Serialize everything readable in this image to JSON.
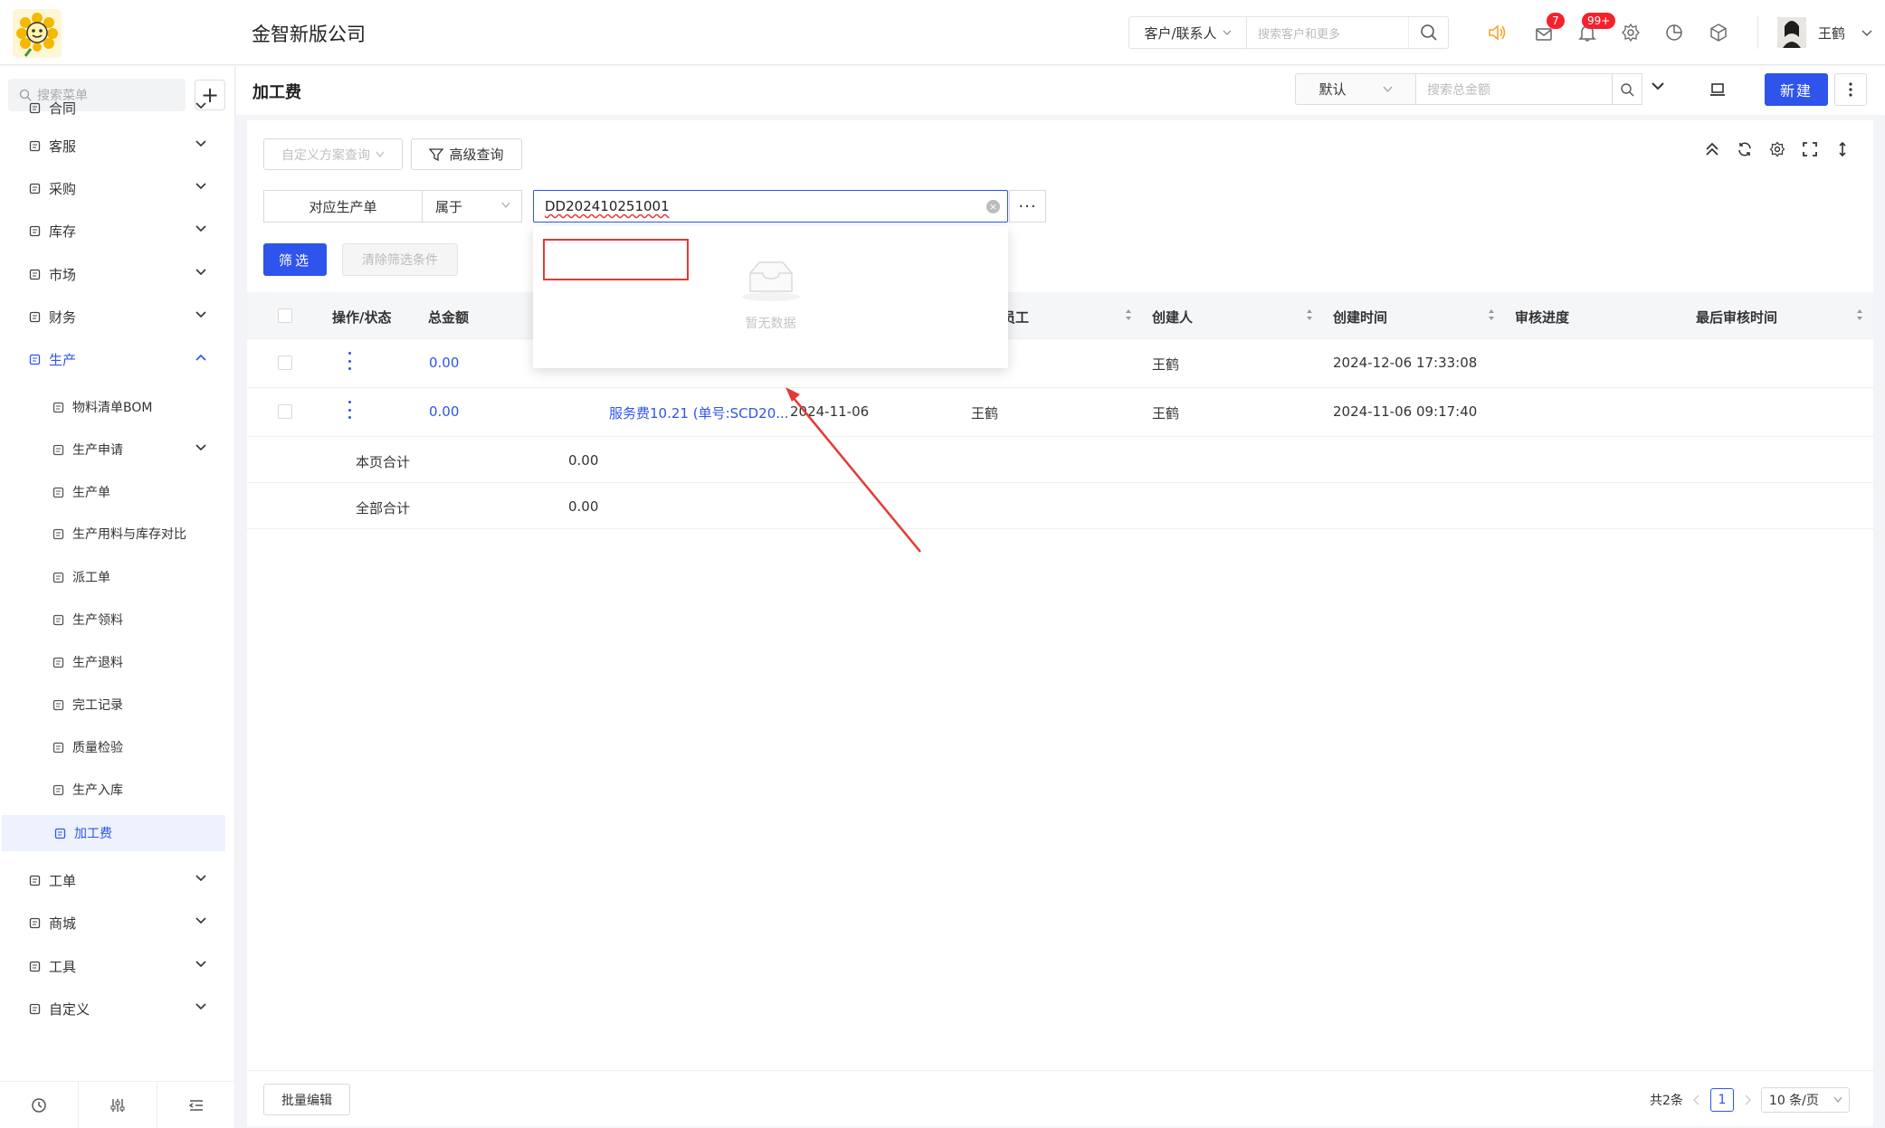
{
  "header": {
    "company": "金智新版公司",
    "search_scope": "客户/联系人",
    "search_placeholder": "搜索客户和更多",
    "mail_badge": "7",
    "notify_badge": "99+",
    "user_name": "王鹤"
  },
  "sidebar": {
    "search_placeholder": "搜索菜单",
    "items": [
      {
        "label": "合同",
        "icon": "contract-icon"
      },
      {
        "label": "客服",
        "icon": "service-icon"
      },
      {
        "label": "采购",
        "icon": "purchase-icon"
      },
      {
        "label": "库存",
        "icon": "inventory-icon"
      },
      {
        "label": "市场",
        "icon": "market-icon"
      },
      {
        "label": "财务",
        "icon": "finance-icon"
      },
      {
        "label": "生产",
        "icon": "production-icon"
      }
    ],
    "production_sub": [
      {
        "label": "物料清单BOM"
      },
      {
        "label": "生产申请"
      },
      {
        "label": "生产单"
      },
      {
        "label": "生产用料与库存对比"
      },
      {
        "label": "派工单"
      },
      {
        "label": "生产领料"
      },
      {
        "label": "生产退料"
      },
      {
        "label": "完工记录"
      },
      {
        "label": "质量检验"
      },
      {
        "label": "生产入库"
      },
      {
        "label": "加工费"
      }
    ],
    "items_after": [
      {
        "label": "工单"
      },
      {
        "label": "商城"
      },
      {
        "label": "工具"
      },
      {
        "label": "自定义"
      }
    ]
  },
  "page": {
    "title": "加工费",
    "view_select": "默认",
    "search_placeholder": "搜索总金额",
    "new_button": "新建"
  },
  "filters": {
    "custom_query": "自定义方案查询",
    "advanced_query": "高级查询",
    "field": "对应生产单",
    "operator": "属于",
    "value": "DD202410251001",
    "apply": "筛选",
    "clear": "清除筛选条件",
    "dropdown_empty": "暂无数据"
  },
  "table": {
    "headers": {
      "op": "操作/状态",
      "amount": "总金额",
      "worker_partial": "员工",
      "creator": "创建人",
      "created_at": "创建时间",
      "review": "审核进度",
      "last_review": "最后审核时间"
    },
    "rows": [
      {
        "amount": "0.00",
        "order": "",
        "date": "",
        "worker": "",
        "creator": "王鹤",
        "created_at": "2024-12-06 17:33:08"
      },
      {
        "amount": "0.00",
        "order": "服务费10.21 (单号:SCD20...",
        "date": "2024-11-06",
        "worker": "王鹤",
        "creator": "王鹤",
        "created_at": "2024-11-06 09:17:40"
      }
    ],
    "page_total_label": "本页合计",
    "page_total_value": "0.00",
    "all_total_label": "全部合计",
    "all_total_value": "0.00"
  },
  "footer": {
    "batch_edit": "批量编辑",
    "total": "共2条",
    "page": "1",
    "page_size": "10 条/页"
  },
  "colors": {
    "accent": "#2f54eb",
    "badge": "#f5222d",
    "annotation": "#e53935"
  }
}
